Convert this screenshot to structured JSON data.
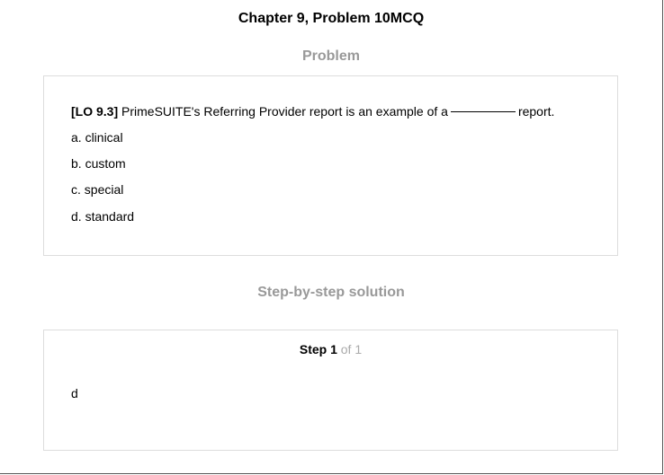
{
  "page": {
    "title": "Chapter 9, Problem 10MCQ"
  },
  "problem": {
    "heading": "Problem",
    "lo_tag": "[LO 9.3]",
    "question_before_blank": "PrimeSUITE's Referring Provider report is an example of a",
    "question_after_blank": "report.",
    "options": [
      "a. clinical",
      "b. custom",
      "c. special",
      "d. standard"
    ]
  },
  "solution": {
    "heading": "Step-by-step solution",
    "step_word": "Step 1",
    "step_of": "of 1",
    "answer": "d"
  },
  "colors": {
    "heading_gray": "#999999",
    "card_border": "#dddddd",
    "step_of_gray": "#aaaaaa"
  }
}
